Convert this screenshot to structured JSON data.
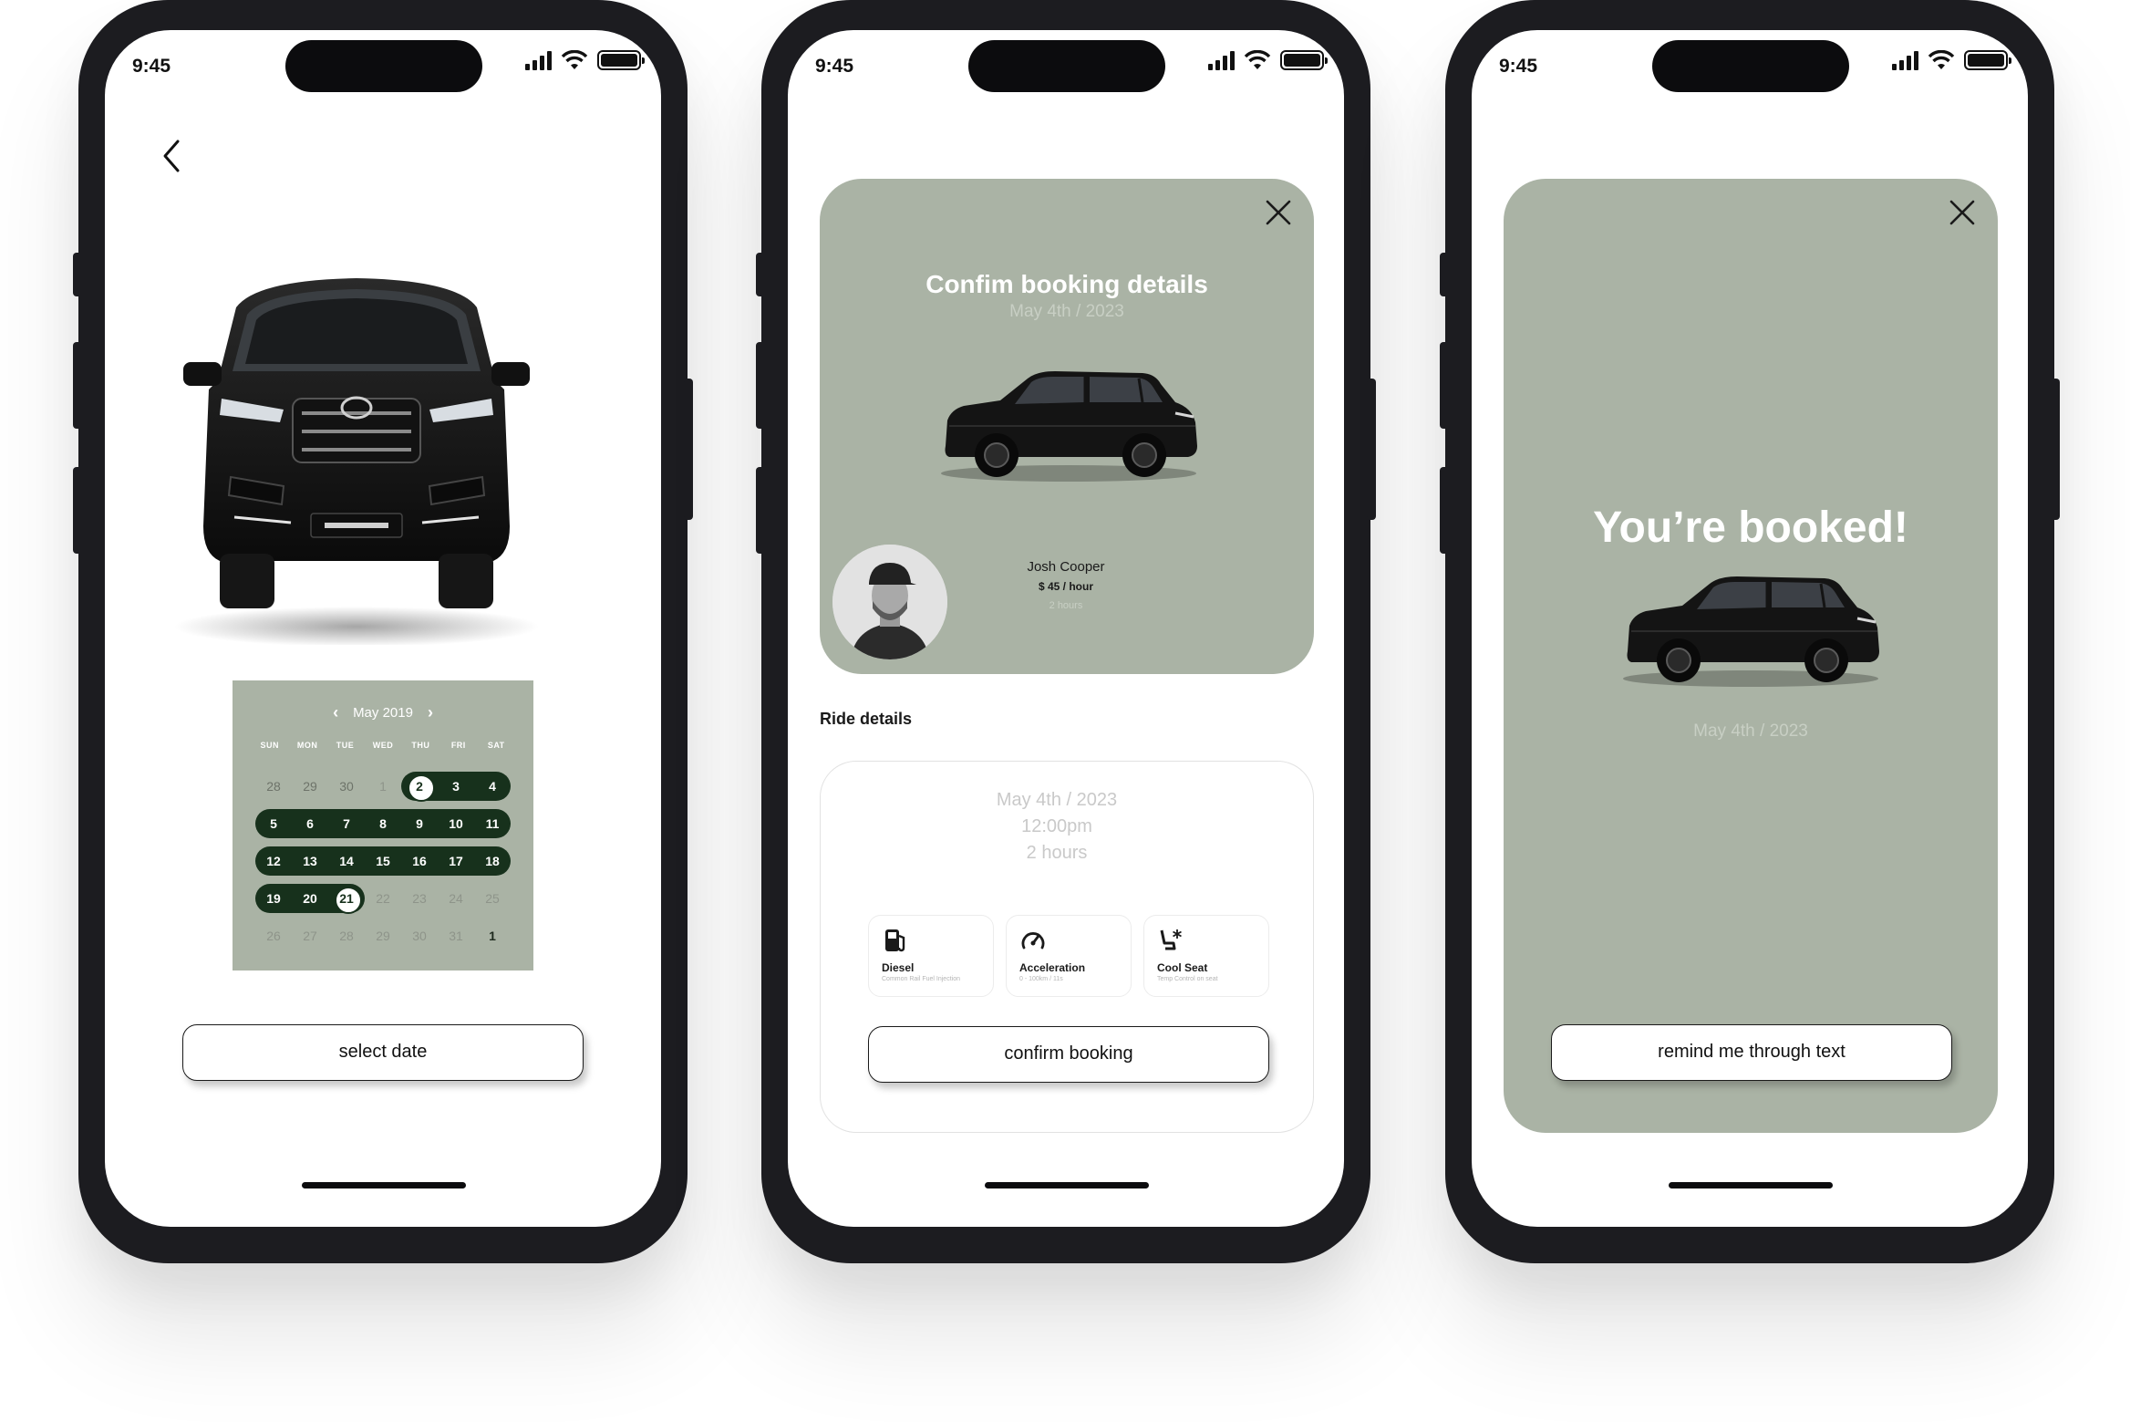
{
  "status_bar": {
    "time": "9:45"
  },
  "screen1": {
    "calendar": {
      "month_label": "May 2019",
      "weekdays": [
        "SUN",
        "MON",
        "TUE",
        "WED",
        "THU",
        "FRI",
        "SAT"
      ],
      "weeks": [
        [
          "28",
          "29",
          "30",
          "1",
          "2",
          "3",
          "4"
        ],
        [
          "5",
          "6",
          "7",
          "8",
          "9",
          "10",
          "11"
        ],
        [
          "12",
          "13",
          "14",
          "15",
          "16",
          "17",
          "18"
        ],
        [
          "19",
          "20",
          "21",
          "22",
          "23",
          "24",
          "25"
        ],
        [
          "26",
          "27",
          "28",
          "29",
          "30",
          "31",
          "1"
        ]
      ],
      "range_start": "2",
      "range_end": "21"
    },
    "select_button": "select date"
  },
  "screen2": {
    "title": "Confim booking details",
    "date": "May 4th / 2023",
    "driver": {
      "name": "Josh Cooper",
      "price": "$ 45 / hour",
      "duration": "2 hours"
    },
    "section_label": "Ride details",
    "ride": {
      "date": "May 4th / 2023",
      "time": "12:00pm",
      "duration": "2 hours"
    },
    "features": [
      {
        "icon": "fuel-pump-icon",
        "title": "Diesel",
        "subtitle": "Common Rail Fuel Injection"
      },
      {
        "icon": "speedometer-icon",
        "title": "Acceleration",
        "subtitle": "0 - 100km / 11s"
      },
      {
        "icon": "cool-seat-icon",
        "title": "Cool Seat",
        "subtitle": "Temp Control on seat"
      }
    ],
    "confirm_button": "confirm booking"
  },
  "screen3": {
    "title": "You’re booked!",
    "date": "May 4th / 2023",
    "remind_button": "remind me through text"
  },
  "colors": {
    "card": "#aab3a5",
    "calendar_range": "#17311c",
    "phone_frame": "#1c1c20"
  }
}
